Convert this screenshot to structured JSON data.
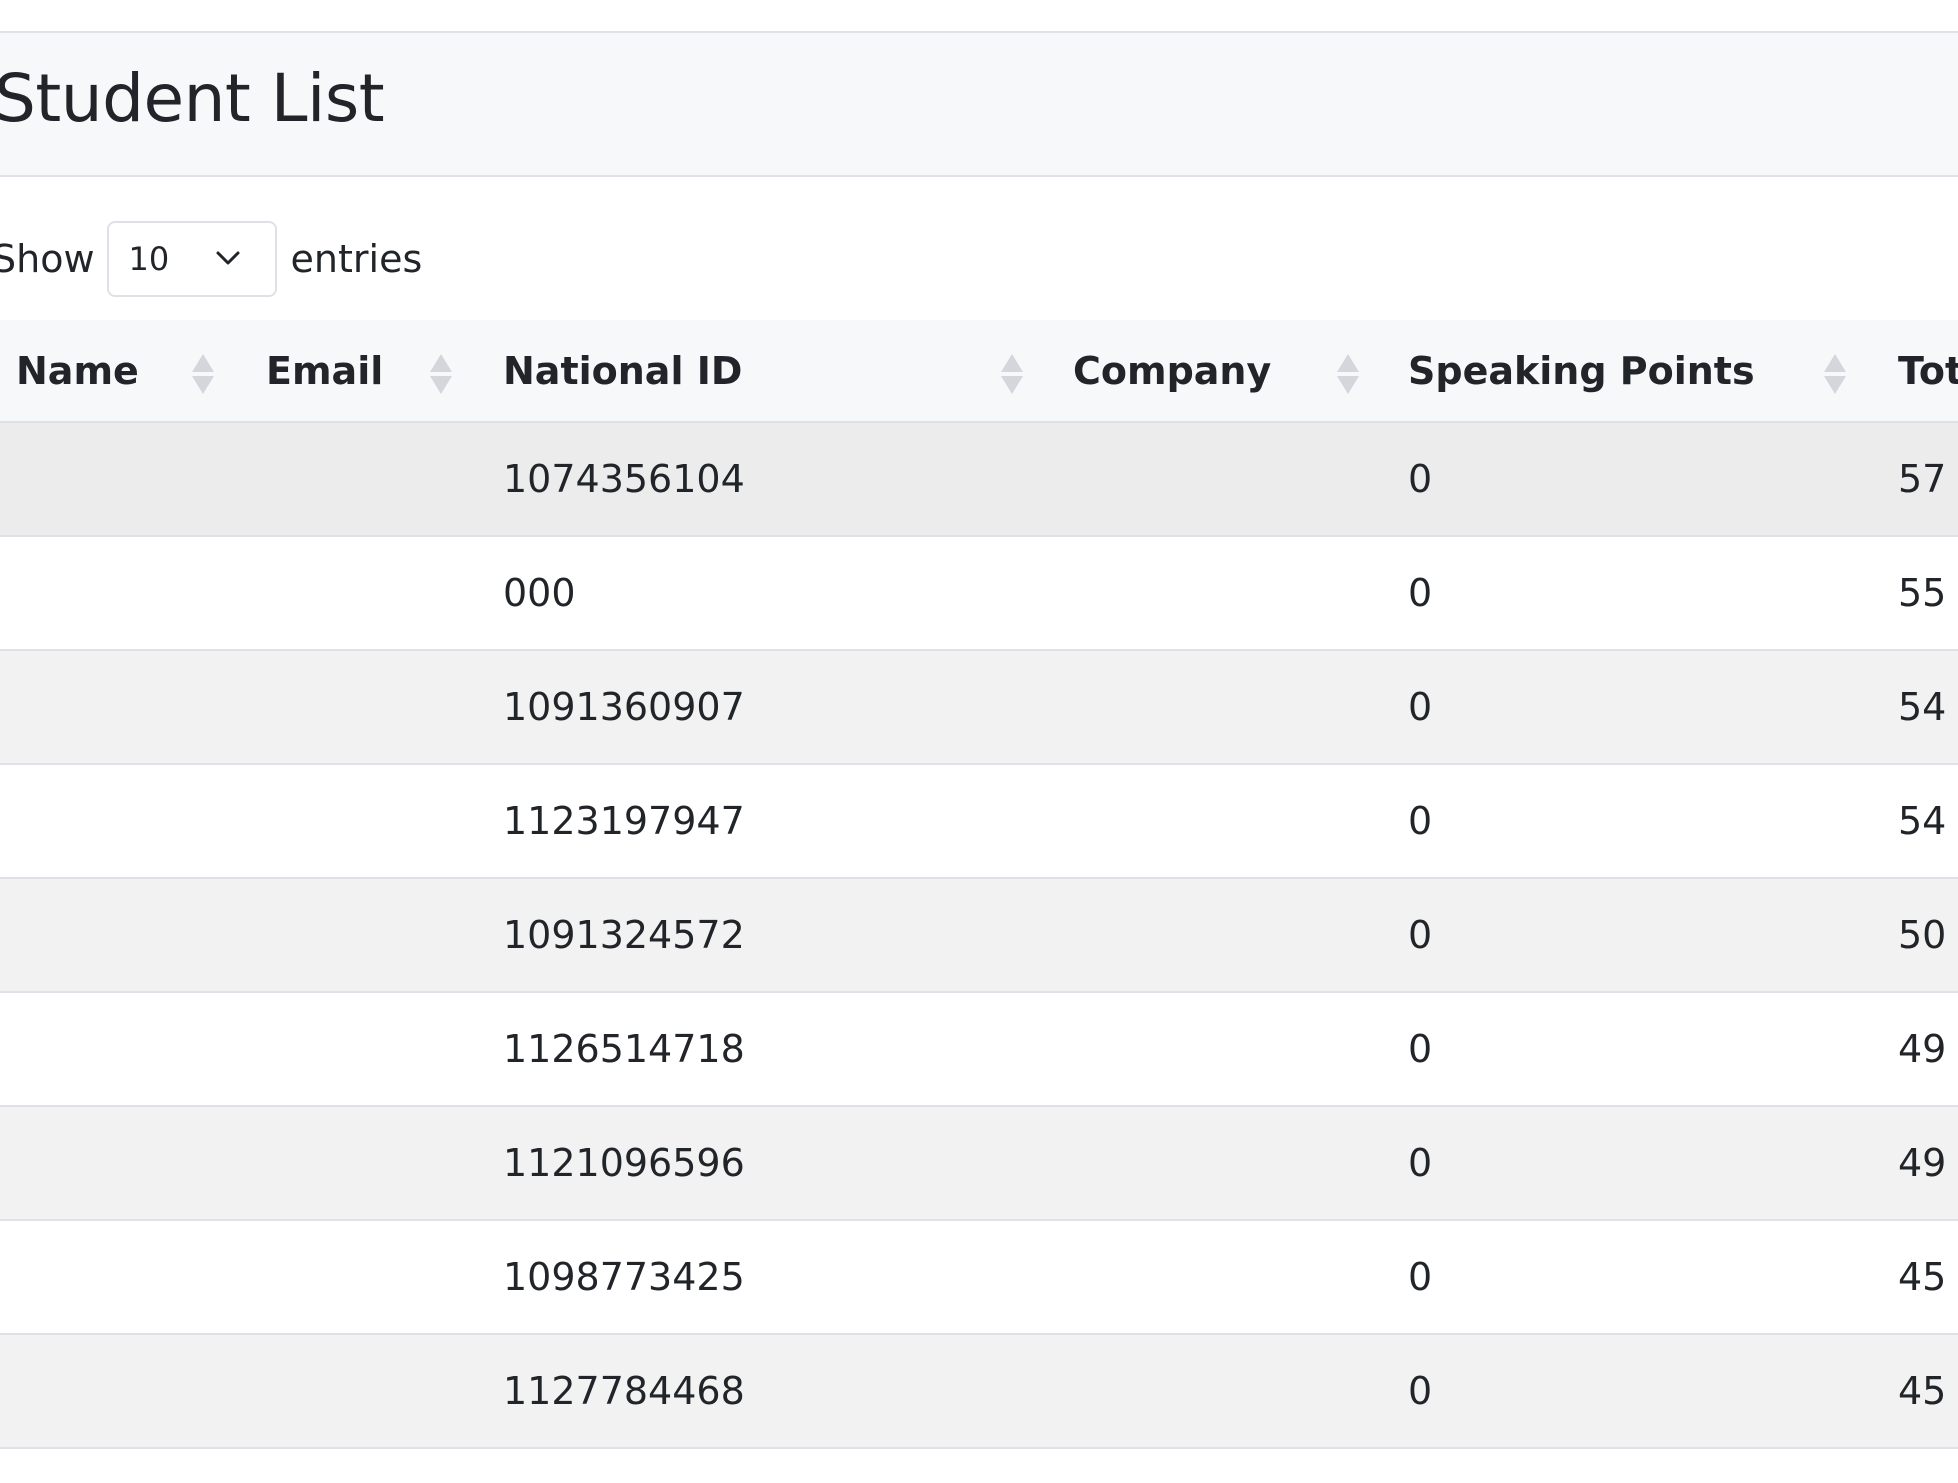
{
  "page": {
    "title": "Student List"
  },
  "length_menu": {
    "prefix": "Show",
    "value": "10",
    "suffix": "entries"
  },
  "table": {
    "columns": [
      {
        "key": "name",
        "label": "Name"
      },
      {
        "key": "email",
        "label": "Email"
      },
      {
        "key": "national_id",
        "label": "National ID"
      },
      {
        "key": "company",
        "label": "Company"
      },
      {
        "key": "speaking_points",
        "label": "Speaking Points"
      },
      {
        "key": "total",
        "label": "Tot"
      }
    ],
    "rows": [
      {
        "name": "",
        "email": "",
        "national_id": "1074356104",
        "company": "",
        "speaking_points": "0",
        "total": "57"
      },
      {
        "name": "",
        "email": "",
        "national_id": "000",
        "company": "",
        "speaking_points": "0",
        "total": "55"
      },
      {
        "name": "",
        "email": "",
        "national_id": "1091360907",
        "company": "",
        "speaking_points": "0",
        "total": "54"
      },
      {
        "name": "",
        "email": "",
        "national_id": "1123197947",
        "company": "",
        "speaking_points": "0",
        "total": "54"
      },
      {
        "name": "",
        "email": "",
        "national_id": "1091324572",
        "company": "",
        "speaking_points": "0",
        "total": "50"
      },
      {
        "name": "",
        "email": "",
        "national_id": "1126514718",
        "company": "",
        "speaking_points": "0",
        "total": "49"
      },
      {
        "name": "",
        "email": "",
        "national_id": "1121096596",
        "company": "",
        "speaking_points": "0",
        "total": "49"
      },
      {
        "name": "",
        "email": "",
        "national_id": "1098773425",
        "company": "",
        "speaking_points": "0",
        "total": "45"
      },
      {
        "name": "",
        "email": "",
        "national_id": "1127784468",
        "company": "",
        "speaking_points": "0",
        "total": "45"
      }
    ]
  },
  "icons": {
    "sort": "sort-both-icon",
    "dropdown": "chevron-down-icon"
  },
  "colors": {
    "header_bg": "#f7f8fa",
    "stripe_bg": "#f2f2f2",
    "hover_bg": "#ececec",
    "border": "#dee2e6",
    "sort_icon": "#d3d6da",
    "text": "#212529"
  }
}
